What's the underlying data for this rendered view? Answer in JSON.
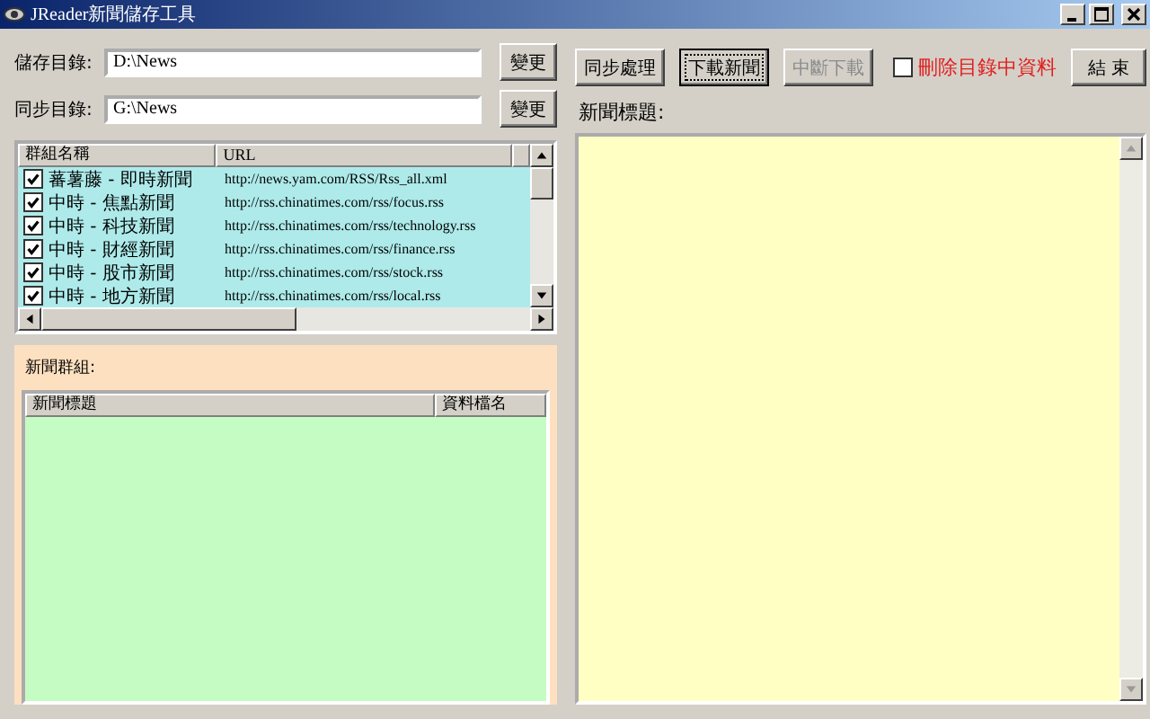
{
  "window": {
    "title": "JReader新聞儲存工具"
  },
  "paths": [
    {
      "label": "儲存目錄:",
      "value": "D:\\News",
      "button": "變更"
    },
    {
      "label": "同步目錄:",
      "value": "G:\\News",
      "button": "變更"
    }
  ],
  "feed_table": {
    "columns": [
      "群組名稱",
      "URL"
    ],
    "rows": [
      {
        "name": "蕃薯藤 - 即時新聞",
        "url": "http://news.yam.com/RSS/Rss_all.xml",
        "checked": true
      },
      {
        "name": "中時 - 焦點新聞",
        "url": "http://rss.chinatimes.com/rss/focus.rss",
        "checked": true
      },
      {
        "name": "中時 - 科技新聞",
        "url": "http://rss.chinatimes.com/rss/technology.rss",
        "checked": true
      },
      {
        "name": "中時 - 財經新聞",
        "url": "http://rss.chinatimes.com/rss/finance.rss",
        "checked": true
      },
      {
        "name": "中時 - 股市新聞",
        "url": "http://rss.chinatimes.com/rss/stock.rss",
        "checked": true
      },
      {
        "name": "中時 - 地方新聞",
        "url": "http://rss.chinatimes.com/rss/local.rss",
        "checked": true
      }
    ]
  },
  "news_group": {
    "label": "新聞群組:",
    "columns": [
      "新聞標題",
      "資料檔名"
    ]
  },
  "actions": [
    {
      "label": "同步處理",
      "disabled": false,
      "focused": false
    },
    {
      "label": "下載新聞",
      "disabled": false,
      "focused": true
    },
    {
      "label": "中斷下載",
      "disabled": true,
      "focused": false
    }
  ],
  "delete_option": {
    "label": "刪除目錄中資料",
    "checked": false
  },
  "exit_button": "結 束",
  "news_title_label": "新聞標題:"
}
